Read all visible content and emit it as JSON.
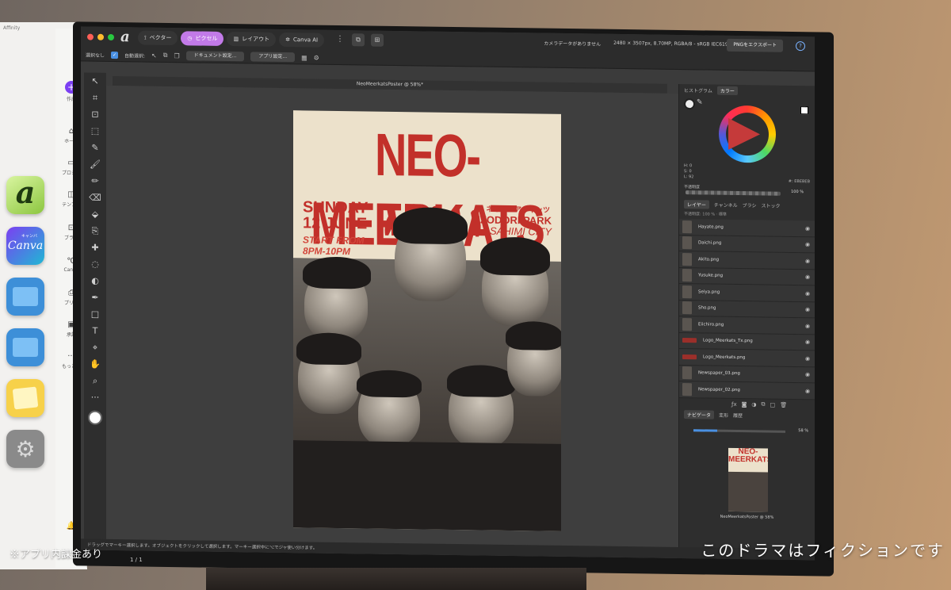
{
  "background": {
    "app_title": "Affinity",
    "sidebar_items": [
      {
        "label": "作成",
        "icon": "plus-icon"
      },
      {
        "label": "ホーム",
        "icon": "home-icon"
      },
      {
        "label": "プロジェ",
        "icon": "folder-icon"
      },
      {
        "label": "テンプレ",
        "icon": "template-icon"
      },
      {
        "label": "ブラン",
        "icon": "brand-icon"
      },
      {
        "label": "Canva",
        "icon": "canva-c-icon"
      },
      {
        "label": "プリン",
        "icon": "print-icon"
      },
      {
        "label": "承認",
        "icon": "inbox-icon"
      },
      {
        "label": "もっと見",
        "icon": "more-icon"
      }
    ],
    "dock_canva_label": "Canva",
    "dock_canva_badge": "キャンバ"
  },
  "toolbar": {
    "personas": [
      {
        "label": "ベクター",
        "icon": "vector-icon",
        "active": false
      },
      {
        "label": "ピクセル",
        "icon": "pixel-icon",
        "active": true
      },
      {
        "label": "レイアウト",
        "icon": "layout-icon",
        "active": false
      },
      {
        "label": "Canva AI",
        "icon": "sparkle-icon",
        "active": false
      }
    ],
    "camera_info": "カメラデータがありません",
    "doc_info": "2480 × 3507px, 8.70MP, RGBA/8 - sRGB IEC61966-2.1",
    "export_label": "PNGをエクスポート"
  },
  "context_bar": {
    "select_none": "選択なし",
    "auto_select": "自動選択:",
    "document_settings": "ドキュメント設定...",
    "app_settings": "アプリ設定..."
  },
  "document": {
    "title": "NeoMeerkatsPoster @ 58%*"
  },
  "poster": {
    "title": "NEO-MEERKATS",
    "date_line1": "SUNDAY",
    "date_line2": "12 JUNE",
    "time_line1": "START FROM",
    "time_line2": "8PM-10PM",
    "jp_name": "ネオミーアキャッツ",
    "venue": "JIZODORI PARK",
    "city": "ASAHIMI CITY"
  },
  "color_panel": {
    "tabs": [
      "ヒストグラム",
      "カラー"
    ],
    "active_tab": "カラー",
    "h": "H: 0",
    "s": "S: 0",
    "l": "L: 92",
    "hex": "#: EBEBEB",
    "opacity_label": "不透明度",
    "opacity_value": "100 %"
  },
  "layers_panel": {
    "tabs": [
      "レイヤー",
      "チャンネル",
      "ブラシ",
      "ストック"
    ],
    "active_tab": "レイヤー",
    "opacity_row": "不透明度: 100 %  ·  標準",
    "layers": [
      {
        "name": "Hayate.png",
        "thumb": "photo"
      },
      {
        "name": "Daichi.png",
        "thumb": "photo"
      },
      {
        "name": "Akito.png",
        "thumb": "photo"
      },
      {
        "name": "Yusuke.png",
        "thumb": "photo"
      },
      {
        "name": "Seiya.png",
        "thumb": "photo"
      },
      {
        "name": "Sho.png",
        "thumb": "photo"
      },
      {
        "name": "Eiichiro.png",
        "thumb": "photo"
      },
      {
        "name": "Logo_Meerkats_Tx.png",
        "thumb": "red"
      },
      {
        "name": "Logo_Meerkats.png",
        "thumb": "red"
      },
      {
        "name": "Newspaper_03.png",
        "thumb": "photo"
      },
      {
        "name": "Newspaper_02.png",
        "thumb": "photo"
      }
    ]
  },
  "navigator_panel": {
    "tabs": [
      "ナビゲータ",
      "変形",
      "履歴"
    ],
    "active_tab": "ナビゲータ",
    "zoom": "58 %",
    "caption": "NeoMeerkatsPoster @ 58%",
    "thumb_title": "NEO-MEERKATS"
  },
  "status_bar": {
    "text": "ドラッグでマーキー選択します。オブジェクトをクリックして選択します。マーキー選択中に⌥でジャ使い分けます。",
    "page": "1 / 1"
  },
  "captions": {
    "left": "※アプリ内課金あり",
    "right": "このドラマはフィクションです"
  }
}
